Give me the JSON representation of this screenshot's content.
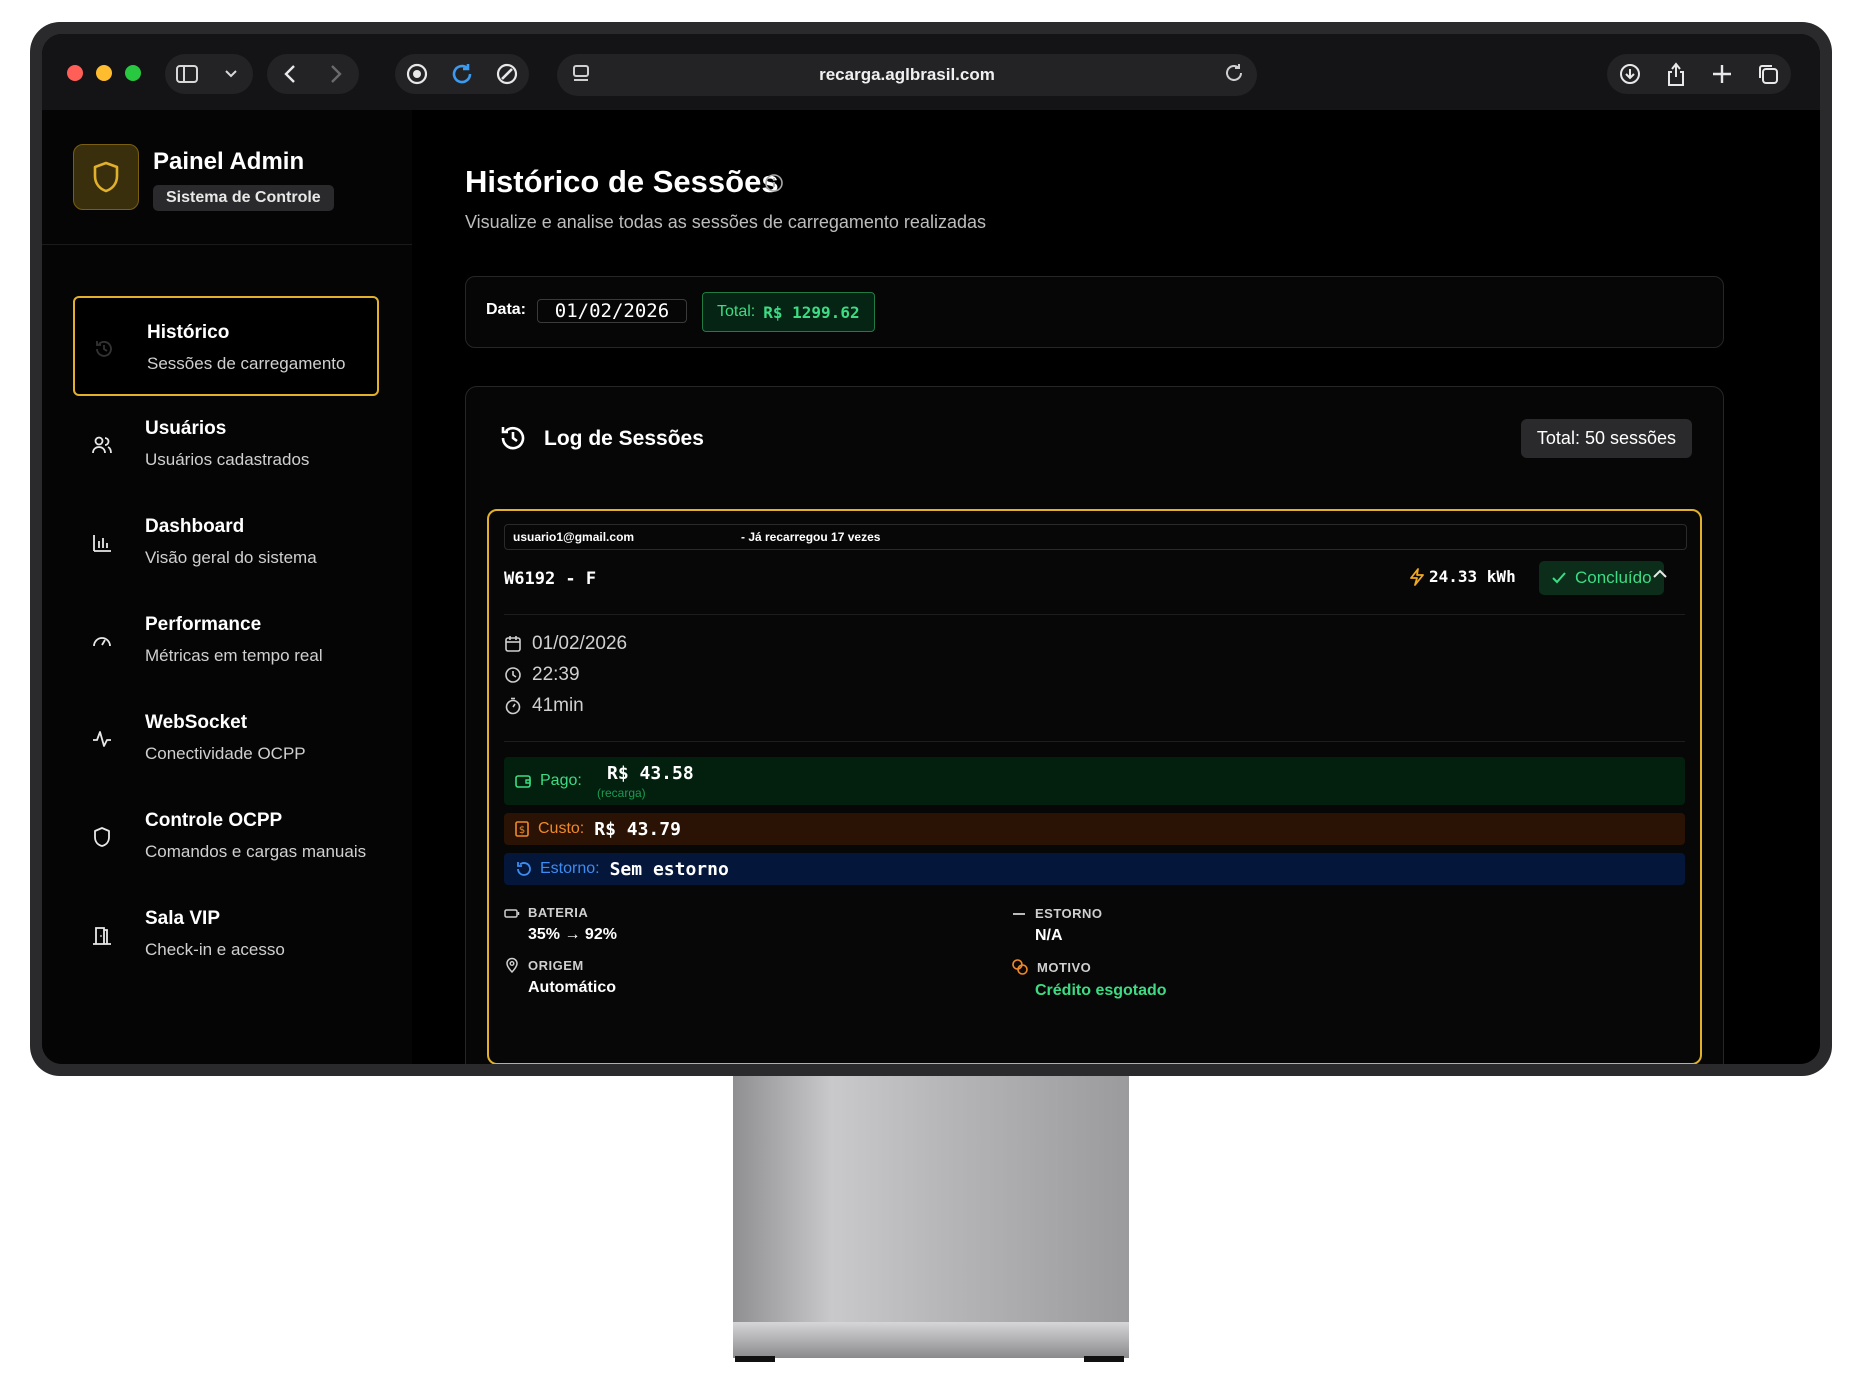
{
  "browser": {
    "url": "recarga.aglbrasil.com"
  },
  "sidebar": {
    "brand_title": "Painel Admin",
    "brand_badge": "Sistema de Controle",
    "items": [
      {
        "title": "Histórico",
        "subtitle": "Sessões de carregamento",
        "icon": "history-icon",
        "active": true
      },
      {
        "title": "Usuários",
        "subtitle": "Usuários cadastrados",
        "icon": "users-icon",
        "active": false
      },
      {
        "title": "Dashboard",
        "subtitle": "Visão geral do sistema",
        "icon": "bar-chart-icon",
        "active": false
      },
      {
        "title": "Performance",
        "subtitle": "Métricas em tempo real",
        "icon": "gauge-icon",
        "active": false
      },
      {
        "title": "WebSocket",
        "subtitle": "Conectividade OCPP",
        "icon": "activity-icon",
        "active": false
      },
      {
        "title": "Controle OCPP",
        "subtitle": "Comandos e cargas manuais",
        "icon": "shield-icon",
        "active": false
      },
      {
        "title": "Sala VIP",
        "subtitle": "Check-in e acesso",
        "icon": "door-icon",
        "active": false
      }
    ]
  },
  "main": {
    "title": "Histórico de Sessões",
    "subtitle": "Visualize e analise todas as sessões de carregamento realizadas",
    "filter": {
      "date_label": "Data:",
      "date_value": "01/02/2026",
      "total_label": "Total:",
      "total_value": "R$ 1299.62"
    },
    "log": {
      "title": "Log de Sessões",
      "count": "Total: 50 sessões",
      "session": {
        "email": "usuario1@gmail.com",
        "recharge_note": "- Já recarregou 17 vezes",
        "charger": "W6192 - F",
        "energy": "24.33 kWh",
        "status": "Concluído",
        "date": "01/02/2026",
        "time": "22:39",
        "duration": "41min",
        "pago_label": "Pago:",
        "pago_value": "R$ 43.58",
        "pago_note": "(recarga)",
        "custo_label": "Custo:",
        "custo_value": "R$ 43.79",
        "estorno_label": "Estorno:",
        "estorno_value": "Sem estorno",
        "bateria_label": "BATERIA",
        "bateria_value": "35% → 92%",
        "estorno2_label": "ESTORNO",
        "estorno2_value": "N/A",
        "origem_label": "ORIGEM",
        "origem_value": "Automático",
        "motivo_label": "MOTIVO",
        "motivo_value": "Crédito esgotado"
      }
    }
  },
  "colors": {
    "accent": "#e1b12c",
    "success": "#3ddc84",
    "warning": "#f08a2a",
    "info": "#3e8cf0"
  }
}
